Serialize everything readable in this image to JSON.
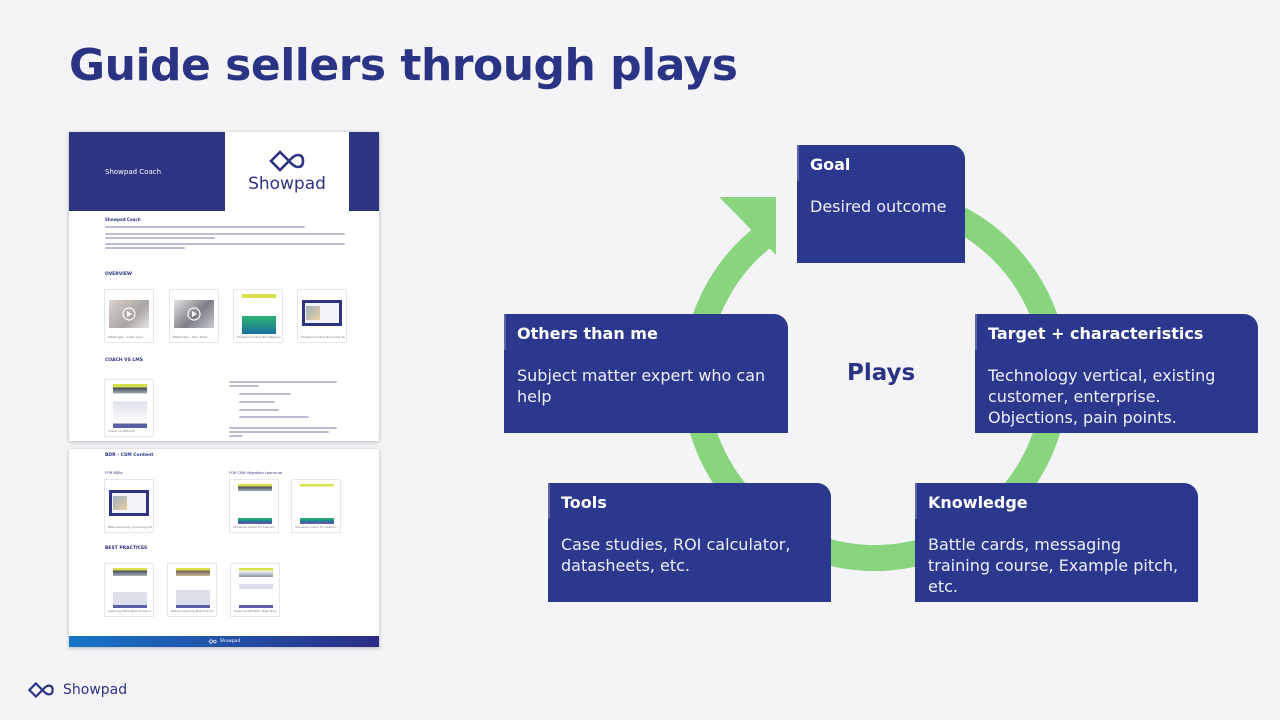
{
  "slide": {
    "title_regular": "Guide sellers through ",
    "title_bold": "plays"
  },
  "document": {
    "hero_title": "Showpad Coach",
    "logo_word": "Showpad",
    "intro_heading": "Showpad Coach",
    "section_overview": "OVERVIEW",
    "overview_cards": [
      {
        "caption": "MeetingIQ – Anika Lace"
      },
      {
        "caption": "MeetingIQ – John Travis"
      },
      {
        "caption": "Showpad Coach One Pager.pdf"
      },
      {
        "caption": "Showpad Coach Overview de..."
      }
    ],
    "section_coach_vs_lms": "COACH VS LMS",
    "coach_vs_lms_card": {
      "caption": "Coach vs LMS.pdf"
    },
    "coach_vs_lms_intro": "With Showpad Coach, sellers get a more complete training and coaching experience in:",
    "coach_vs_lms_bullets": [
      "Recording and perfecting their pitches.",
      "Sharing best practices.",
      "Learning from top performers.",
      "Receiving assessment and feedback on their abilities."
    ],
    "coach_vs_lms_outro": "Comparing training and coaching features between an LMS and a sales enablement solution like Showpad Coach can help you identify the best tool to serve your pain points.",
    "section_bdr_csm": "BDR - CSM Content",
    "sub_for_bdrs": "FOR BDRs",
    "sub_for_csm": "FOR CSM: Migration Learnsure",
    "bdr_cards": [
      {
        "caption": "BDR Campaign_Coaching.pdf"
      }
    ],
    "csm_cards": [
      {
        "caption": "Showpad Coach for Learnin..."
      },
      {
        "caption": "Showpad Coach for Learnin..."
      }
    ],
    "section_best_practices": "BEST PRACTICES",
    "best_practice_cards": [
      {
        "caption": "Learning Paths Best Practice..."
      },
      {
        "caption": "Mobile Learning Best Practic..."
      },
      {
        "caption": "Sales Certification Best Prac..."
      }
    ],
    "footer_brand": "Showpad"
  },
  "diagram": {
    "center_label": "Plays",
    "cycle_color": "#88d57e",
    "box_color": "#2c378e",
    "boxes": {
      "goal": {
        "heading": "Goal",
        "body": "Desired outcome"
      },
      "target": {
        "heading": "Target + characteristics",
        "body": "Technology vertical, existing customer, enterprise. Objections, pain points."
      },
      "knowledge": {
        "heading": "Knowledge",
        "body": "Battle cards, messaging training course, Example pitch, etc."
      },
      "tools": {
        "heading": "Tools",
        "body": "Case studies, ROI calculator, datasheets, etc."
      },
      "others": {
        "heading": "Others than me",
        "body": "Subject matter expert who can help"
      }
    }
  },
  "footer": {
    "brand": "Showpad"
  }
}
